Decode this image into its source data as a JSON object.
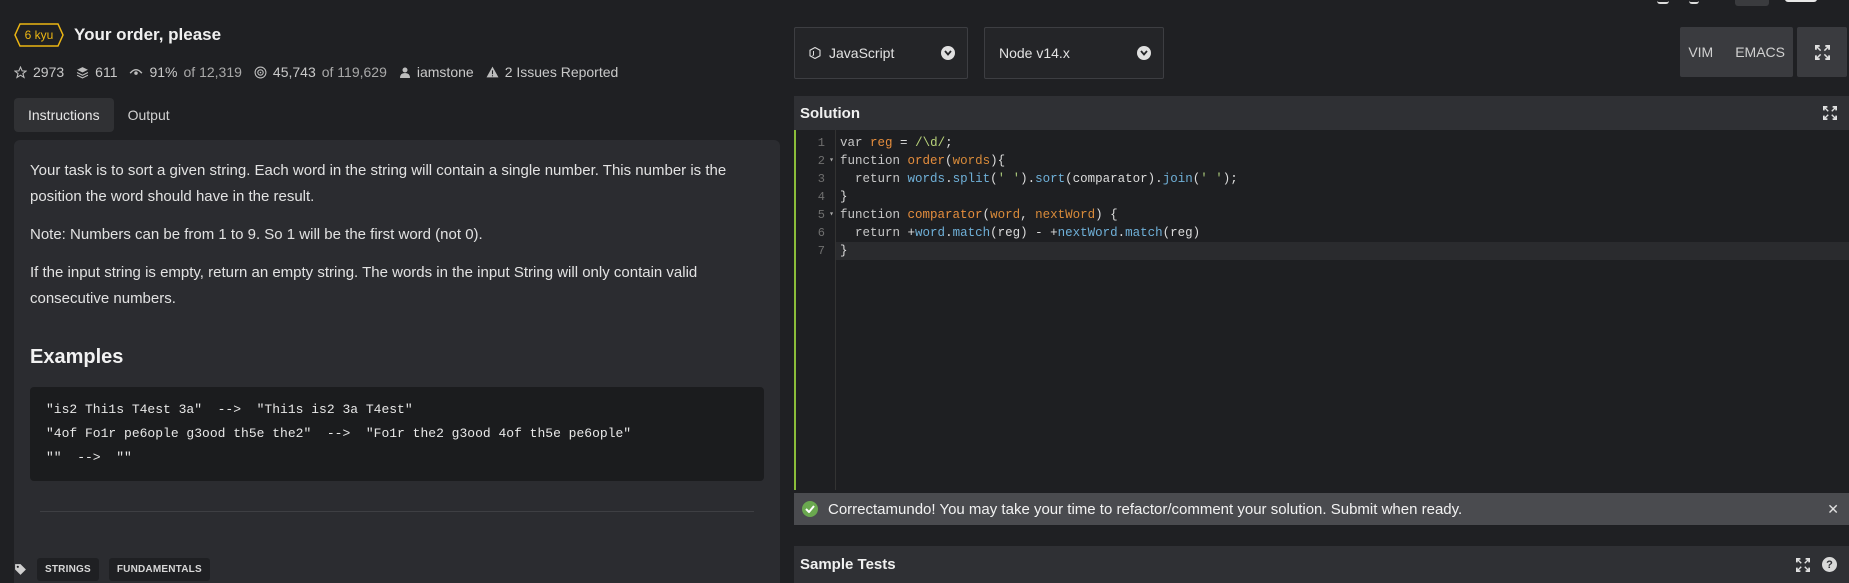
{
  "kata": {
    "rank": "6 kyu",
    "title": "Your order, please",
    "rank_color": "#ecb613"
  },
  "stats": {
    "stars": "2973",
    "collections": "611",
    "satisfaction": "91%",
    "satisfaction_of": "of 12,319",
    "completed": "45,743",
    "completed_of": "of 119,629",
    "author": "iamstone",
    "issues": "2 Issues Reported"
  },
  "tabs": [
    "Instructions",
    "Output"
  ],
  "description": {
    "p1": "Your task is to sort a given string. Each word in the string will contain a single number. This number is the position the word should have in the result.",
    "p2": "Note: Numbers can be from 1 to 9. So 1 will be the first word (not 0).",
    "p3": "If the input string is empty, return an empty string. The words in the input String will only contain valid consecutive numbers.",
    "examples_heading": "Examples",
    "examples": [
      "\"is2 Thi1s T4est 3a\"  -->  \"Thi1s is2 3a T4est\"",
      "\"4of Fo1r pe6ople g3ood th5e the2\"  -->  \"Fo1r the2 g3ood 4of th5e pe6ople\"",
      "\"\"  -->  \"\""
    ]
  },
  "tags": [
    "STRINGS",
    "FUNDAMENTALS"
  ],
  "toolbar": {
    "language": "JavaScript",
    "runtime": "Node v14.x",
    "vim": "VIM",
    "emacs": "EMACS"
  },
  "solution": {
    "title": "Solution",
    "line_numbers": [
      "1",
      "2",
      "3",
      "4",
      "5",
      "6",
      "7"
    ]
  },
  "status": {
    "message": "Correctamundo! You may take your time to refactor/comment your solution. Submit when ready.",
    "color": "#6aa84f"
  },
  "sample_tests": {
    "title": "Sample Tests",
    "help": "?"
  }
}
